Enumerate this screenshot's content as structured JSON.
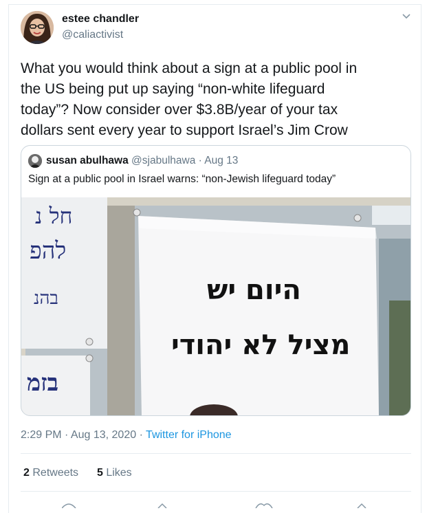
{
  "author": {
    "name": "estee chandler",
    "handle": "@caliactivist"
  },
  "tweet": {
    "text": "What you would think about a sign at a public pool in\nthe US being put up saying “non-white lifeguard\ntoday”? Now consider over $3.8B/year of your tax\ndollars sent every year to support Israel’s Jim Crow"
  },
  "quoted": {
    "name": "susan abulhawa",
    "handle": "@sjabulhawa",
    "date": "· Aug 13",
    "text": "Sign at a public pool in Israel warns: “non-Jewish lifeguard today”",
    "photo": {
      "sign_line1": "היום יש",
      "sign_line2": "מציל לא יהודי",
      "left_sign_fragments": [
        "חל נ",
        "להפ",
        "בהנ",
        "בזמ"
      ]
    }
  },
  "meta": {
    "time": "2:29 PM · Aug 13, 2020 ·",
    "source": "Twitter for iPhone"
  },
  "stats": {
    "retweets_count": "2",
    "retweets_label": "Retweets",
    "likes_count": "5",
    "likes_label": "Likes"
  },
  "icons": [
    "chevron-down-icon",
    "reply-icon",
    "retweet-icon",
    "like-icon",
    "share-icon"
  ],
  "colors": {
    "link": "#1b95e0",
    "secondary_text": "#657786",
    "border": "#e6ecf0"
  }
}
